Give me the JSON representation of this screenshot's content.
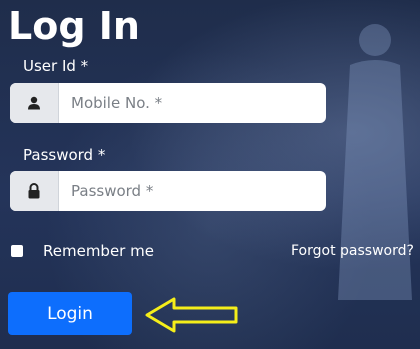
{
  "page": {
    "title": "Log In"
  },
  "form": {
    "user_id": {
      "label": "User Id *",
      "placeholder": "Mobile No. *"
    },
    "password": {
      "label": "Password *",
      "placeholder": "Password *"
    },
    "remember_label": "Remember me",
    "forgot_label": "Forgot password?",
    "login_label": "Login"
  },
  "icons": {
    "user": "user-icon",
    "lock": "lock-icon",
    "arrow": "left-arrow-icon"
  },
  "colors": {
    "background": "#223152",
    "primary_button": "#0d6efd",
    "arrow": "#f5ee1a"
  }
}
